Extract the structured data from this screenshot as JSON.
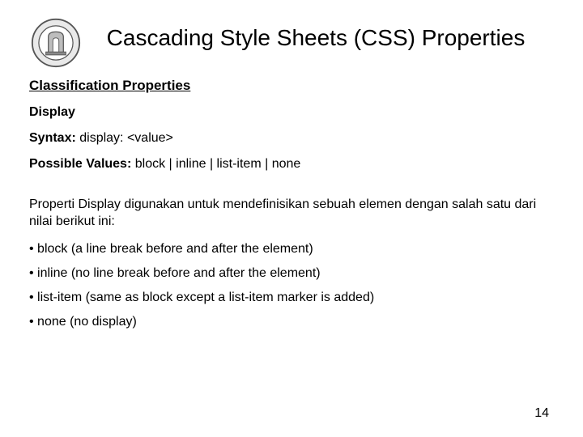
{
  "title": "Cascading Style Sheets (CSS) Properties",
  "section_heading": "Classification Properties",
  "subheading": "Display",
  "syntax": {
    "label": "Syntax:",
    "value": "display: <value>"
  },
  "possible_values": {
    "label": "Possible Values:",
    "value": "block | inline | list-item | none"
  },
  "body_text": "Properti Display digunakan untuk mendefinisikan sebuah elemen dengan salah satu dari nilai berikut ini:",
  "bullets": [
    "block (a line break before and after the element)",
    "inline (no line break before and after the element)",
    "list-item (same as block except a list-item marker is added)",
    "none (no display)"
  ],
  "page_number": "14"
}
